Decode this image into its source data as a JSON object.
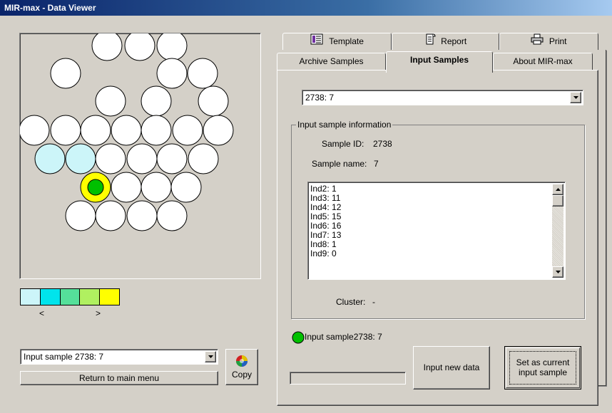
{
  "window": {
    "title": "MIR-max - Data Viewer"
  },
  "map": {
    "colors": {
      "white": "#ffffff",
      "cyan_light": "#ccf5f9",
      "yellow": "#ffff00",
      "green": "#00c000"
    }
  },
  "legend": {
    "swatches": [
      "#ccf5f9",
      "#00e4ec",
      "#55e09a",
      "#b0f060",
      "#ffff00"
    ],
    "left_arrow": "<",
    "right_arrow": ">"
  },
  "left_combo": {
    "value": "Input sample 2738: 7"
  },
  "buttons": {
    "return": "Return to main menu",
    "copy": "Copy",
    "input_new_data": "Input new data",
    "set_current_line1": "Set as current",
    "set_current_line2": "input sample"
  },
  "tabs": {
    "row1": [
      {
        "label": "Template",
        "icon": "template-icon"
      },
      {
        "label": "Report",
        "icon": "report-icon"
      },
      {
        "label": "Print",
        "icon": "printer-icon"
      }
    ],
    "row2": [
      {
        "label": "Archive Samples"
      },
      {
        "label": "Input Samples",
        "active": true
      },
      {
        "label": "About MIR-max"
      }
    ]
  },
  "sample_combo": {
    "value": "2738: 7"
  },
  "info": {
    "group_title": "Input sample information",
    "sample_id_label": "Sample ID:",
    "sample_id_value": "2738",
    "sample_name_label": "Sample name:",
    "sample_name_value": "7",
    "cluster_label": "Cluster:",
    "cluster_value": "-",
    "indicators": [
      "Ind2: 1",
      "Ind3: 11",
      "Ind4: 12",
      "Ind5: 15",
      "Ind6: 16",
      "Ind7: 13",
      "Ind8: 1",
      "Ind9: 0"
    ]
  },
  "status": {
    "text": "Input sample2738: 7"
  }
}
